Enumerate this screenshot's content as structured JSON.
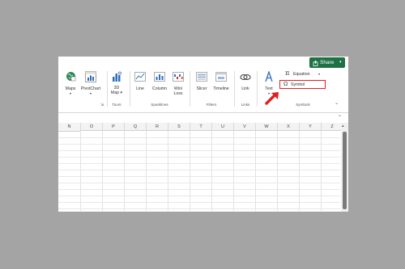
{
  "share": {
    "label": "Share",
    "color": "#1e7145"
  },
  "ribbon": {
    "buttons": [
      {
        "key": "maps",
        "label": "Maps",
        "icon": "globe-map-icon"
      },
      {
        "key": "pivotchart",
        "label": "PivotChart",
        "icon": "pivotchart-icon"
      },
      {
        "key": "3dmap",
        "label1": "3D",
        "label2": "Map",
        "icon": "3d-map-icon"
      },
      {
        "key": "line",
        "label": "Line",
        "icon": "sparkline-line-icon"
      },
      {
        "key": "column",
        "label": "Column",
        "icon": "sparkline-column-icon"
      },
      {
        "key": "winloss",
        "label1": "Win/",
        "label2": "Loss",
        "icon": "sparkline-winloss-icon"
      },
      {
        "key": "slicer",
        "label": "Slicer",
        "icon": "slicer-icon"
      },
      {
        "key": "timeline",
        "label": "Timeline",
        "icon": "timeline-icon"
      },
      {
        "key": "link",
        "label": "Link",
        "icon": "link-icon"
      },
      {
        "key": "text",
        "label": "Text",
        "icon": "text-icon"
      },
      {
        "key": "equation",
        "label": "Equation",
        "icon": "pi-icon"
      },
      {
        "key": "symbol",
        "label": "Symbol",
        "icon": "omega-icon"
      }
    ],
    "groups": {
      "tours": "Tours",
      "sparklines": "Sparklines",
      "filters": "Filters",
      "links": "Links",
      "symbols": "Symbols"
    },
    "highlight_color": "#e02020"
  },
  "columns": [
    "N",
    "O",
    "P",
    "Q",
    "R",
    "S",
    "T",
    "U",
    "V",
    "W",
    "X",
    "Y",
    "Z"
  ]
}
